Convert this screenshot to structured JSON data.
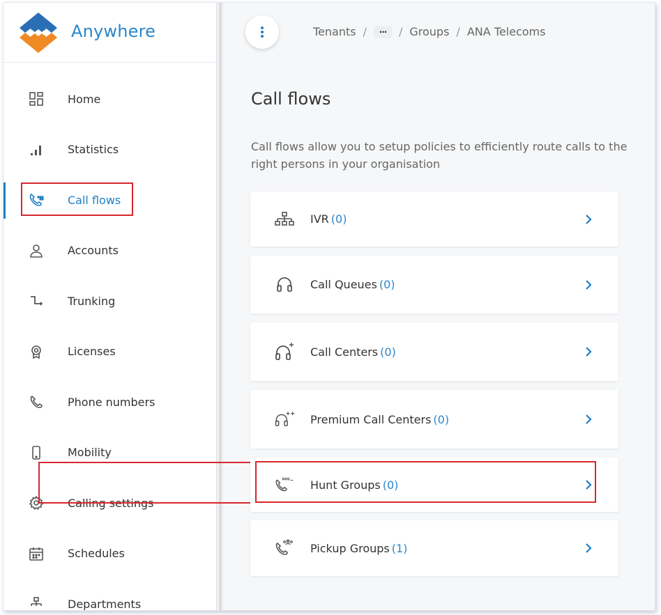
{
  "app": {
    "name": "Anywhere",
    "accent": "#1e7fc7",
    "logo_colors": [
      "#2a6fb6",
      "#f08a24"
    ]
  },
  "sidebar": {
    "items": [
      {
        "label": "Home",
        "icon": "dashboard-icon",
        "active": false
      },
      {
        "label": "Statistics",
        "icon": "bar-chart-icon",
        "active": false
      },
      {
        "label": "Call flows",
        "icon": "call-flow-icon",
        "active": true
      },
      {
        "label": "Accounts",
        "icon": "person-icon",
        "active": false
      },
      {
        "label": "Trunking",
        "icon": "trunk-icon",
        "active": false
      },
      {
        "label": "Licenses",
        "icon": "license-badge-icon",
        "active": false
      },
      {
        "label": "Phone numbers",
        "icon": "phone-icon",
        "active": false
      },
      {
        "label": "Mobility",
        "icon": "mobile-icon",
        "active": false
      },
      {
        "label": "Calling settings",
        "icon": "gear-icon",
        "active": false
      },
      {
        "label": "Schedules",
        "icon": "calendar-icon",
        "active": false
      },
      {
        "label": "Departments",
        "icon": "org-chart-icon",
        "active": false
      }
    ]
  },
  "header": {
    "menu_icon": "vertical-dots-icon",
    "breadcrumb": [
      "Tenants",
      "···",
      "Groups",
      "ANA Telecoms"
    ]
  },
  "main": {
    "title": "Call flows",
    "description": "Call flows allow you to setup policies to efficiently route calls to the right persons in your organisation",
    "cards": [
      {
        "label": "IVR",
        "count": "(0)",
        "icon": "ivr-tree-icon"
      },
      {
        "label": "Call Queues",
        "count": "(0)",
        "icon": "headset-icon"
      },
      {
        "label": "Call Centers",
        "count": "(0)",
        "icon": "headset-plus-icon"
      },
      {
        "label": "Premium Call Centers",
        "count": "(0)",
        "icon": "headset-plus-plus-icon"
      },
      {
        "label": "Hunt Groups",
        "count": "(0)",
        "icon": "hunt-group-icon"
      },
      {
        "label": "Pickup Groups",
        "count": "(1)",
        "icon": "pickup-group-icon"
      }
    ]
  }
}
